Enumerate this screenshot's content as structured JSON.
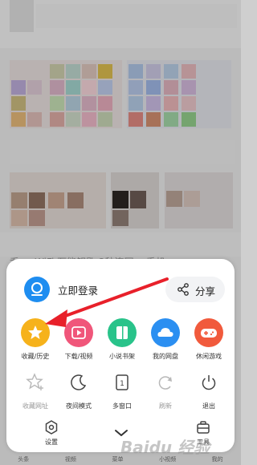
{
  "sheet": {
    "login": {
      "label": "立即登录"
    },
    "share": {
      "label": "分享"
    },
    "grid_row1": [
      {
        "label": "收藏/历史",
        "icon": "star-icon",
        "color": "#f6b21b"
      },
      {
        "label": "下载/视频",
        "icon": "play-icon",
        "color": "#f0567a"
      },
      {
        "label": "小说书架",
        "icon": "book-icon",
        "color": "#29c38a"
      },
      {
        "label": "我的网盘",
        "icon": "cloud-icon",
        "color": "#2b8ff1"
      },
      {
        "label": "休闲游戏",
        "icon": "gamepad-icon",
        "color": "#f15a3c"
      }
    ],
    "grid_row2": [
      {
        "label": "收藏网址",
        "icon": "star-plus-icon"
      },
      {
        "label": "夜间模式",
        "icon": "moon-icon"
      },
      {
        "label": "多窗口",
        "icon": "window-icon",
        "value": "1"
      },
      {
        "label": "刷新",
        "icon": "refresh-icon"
      },
      {
        "label": "退出",
        "icon": "power-icon"
      }
    ],
    "settings": {
      "label": "设置"
    },
    "tools": {
      "label": "工具"
    }
  },
  "bottom_nav": [
    "头条",
    "视频",
    "菜单",
    "小视频",
    "我的"
  ],
  "background_text": "乔 ...    WiFi 万能钥匙  2秒连网... 手机 ...",
  "watermark": "Baidu 经验",
  "colors": {
    "accent_red": "#e8202a",
    "primary_blue": "#1e8df0"
  }
}
